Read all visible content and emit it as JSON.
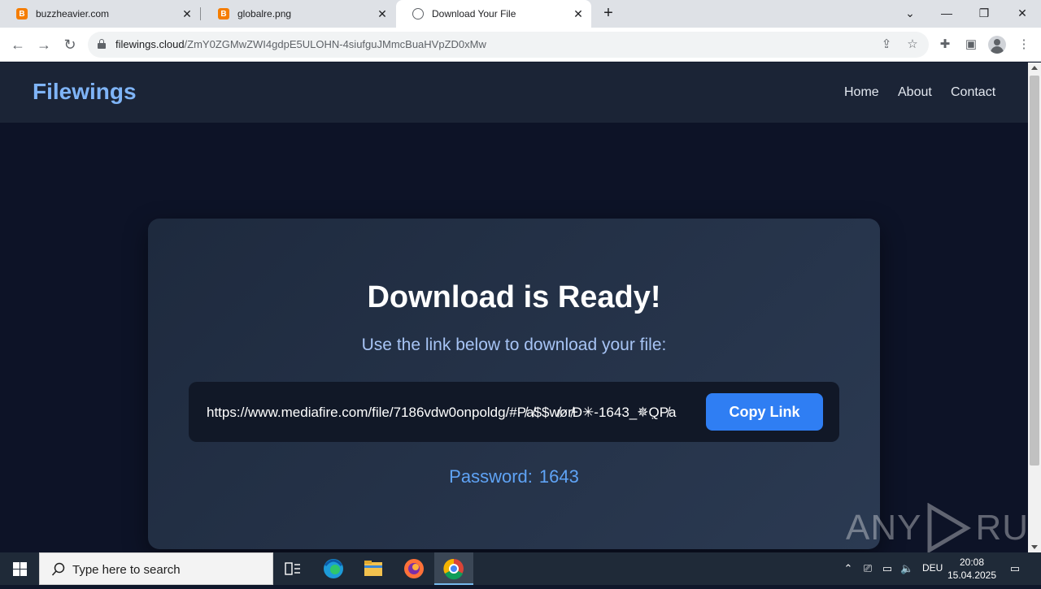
{
  "browser": {
    "tabs": [
      {
        "title": "buzzheavier.com",
        "favicon": "B",
        "active": false
      },
      {
        "title": "globalre.png",
        "favicon": "B",
        "active": false
      },
      {
        "title": "Download Your File",
        "favicon": "globe-icon",
        "active": true
      }
    ],
    "url_host": "filewings.cloud",
    "url_path": "/ZmY0ZGMwZWI4gdpE5ULOHN-4siufguJMmcBuaHVpZD0xMw"
  },
  "site": {
    "brand": "Filewings",
    "nav": [
      "Home",
      "About",
      "Contact"
    ],
    "heading": "Download is Ready!",
    "subheading": "Use the link below to download your file:",
    "link": "https://www.mediafire.com/file/7186vdw0onpoldg/#P̸a̸$$w̸ør̸Ð✳-1643_✵Q̣P̸a",
    "copy_button": "Copy Link",
    "password_label": "Password:",
    "password_value": "1643"
  },
  "watermark": {
    "left": "ANY",
    "right": "RUN"
  },
  "taskbar": {
    "search_placeholder": "Type here to search",
    "language": "DEU",
    "time": "20:08",
    "date": "15.04.2025"
  },
  "colors": {
    "brand": "#7fb4f7",
    "accent": "#2f7ef3",
    "password": "#5fa3f5",
    "page_bg": "#0d1327"
  }
}
